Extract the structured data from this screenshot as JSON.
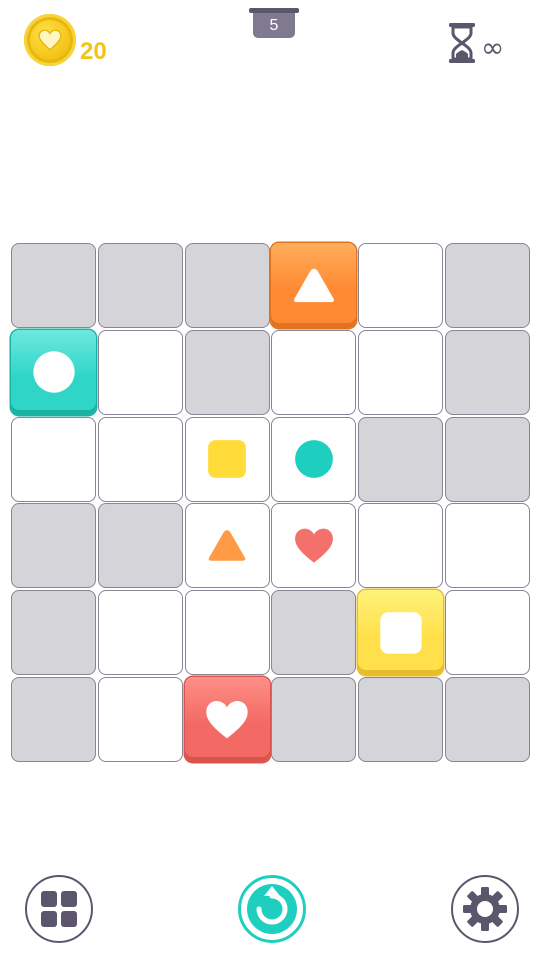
{
  "header": {
    "coins": "20",
    "level": "5",
    "timer_symbol": "∞"
  },
  "board": {
    "rows": 6,
    "cols": 6,
    "grid": [
      [
        "blocked",
        "blocked",
        "blocked",
        "piece-triangle-orange",
        "empty",
        "blocked"
      ],
      [
        "piece-circle-teal",
        "empty",
        "blocked",
        "empty",
        "empty",
        "blocked"
      ],
      [
        "empty",
        "empty",
        "target-square-yellow",
        "target-circle-teal",
        "blocked",
        "blocked"
      ],
      [
        "blocked",
        "blocked",
        "target-triangle-orange",
        "target-heart-red",
        "empty",
        "empty"
      ],
      [
        "blocked",
        "empty",
        "empty",
        "blocked",
        "piece-square-yellow",
        "empty"
      ],
      [
        "blocked",
        "empty",
        "piece-heart-red",
        "blocked",
        "blocked",
        "blocked"
      ]
    ]
  },
  "colors": {
    "orange": "#ff9a45",
    "teal": "#1ecfc0",
    "yellow": "#ffdc3a",
    "red": "#f4706a",
    "blocked": "#d4d4d9",
    "border": "#8a8494",
    "ui_dark": "#5c566d",
    "coin": "#f2c41b"
  },
  "toolbar": {
    "left_icon": "grid-menu-icon",
    "center_icon": "restart-icon",
    "right_icon": "gear-icon"
  }
}
